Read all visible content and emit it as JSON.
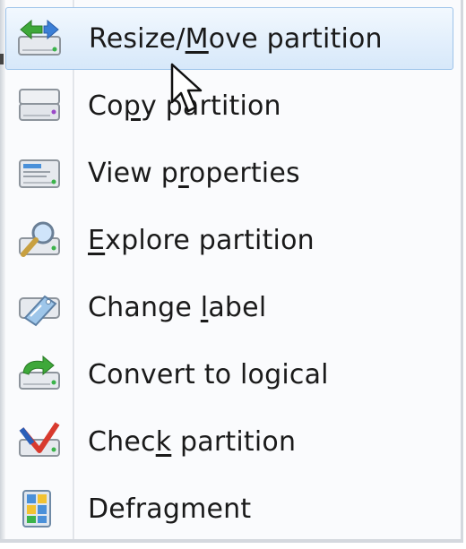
{
  "menu": {
    "items": [
      {
        "pre": "Resize/",
        "mnem": "M",
        "post": "ove partition",
        "icon": "resize-move-partition-icon",
        "hover": true
      },
      {
        "pre": "Co",
        "mnem": "p",
        "post": "y partition",
        "icon": "copy-partition-icon",
        "hover": false
      },
      {
        "pre": "View p",
        "mnem": "r",
        "post": "operties",
        "icon": "view-properties-icon",
        "hover": false
      },
      {
        "pre": "",
        "mnem": "E",
        "post": "xplore partition",
        "icon": "explore-partition-icon",
        "hover": false
      },
      {
        "pre": "Change ",
        "mnem": "l",
        "post": "abel",
        "icon": "change-label-icon",
        "hover": false
      },
      {
        "pre": "Convert to logical",
        "mnem": "",
        "post": "",
        "icon": "convert-to-logical-icon",
        "hover": false
      },
      {
        "pre": "Chec",
        "mnem": "k",
        "post": " partition",
        "icon": "check-partition-icon",
        "hover": false
      },
      {
        "pre": "Defragment",
        "mnem": "",
        "post": "",
        "icon": "defragment-icon",
        "hover": false
      }
    ]
  },
  "colors": {
    "hover_border": "#9ec4ea",
    "hover_fill": "#e4f0fc",
    "text": "#1a1a1a"
  }
}
